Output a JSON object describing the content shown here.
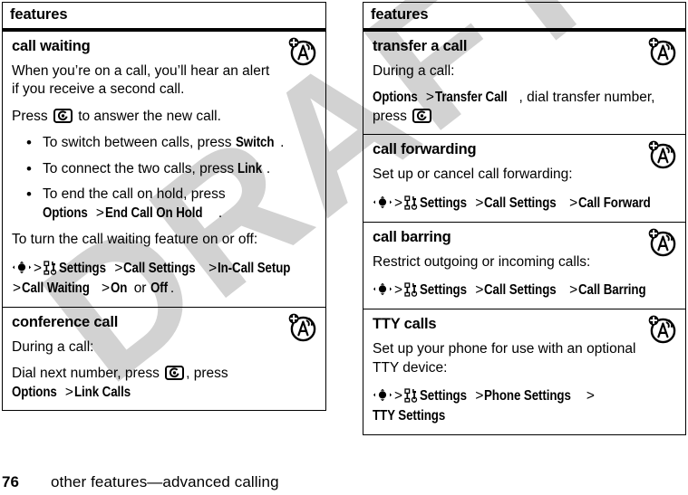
{
  "watermark": {
    "text": "DRAFT",
    "color": "#d2d2d2"
  },
  "footer": {
    "page_number": "76",
    "title": "other features—advanced calling"
  },
  "columns": [
    {
      "header": "features",
      "rows": [
        {
          "title": "call waiting",
          "icon": "network-service-a-icon",
          "paragraphs": [
            "When you’re on a call, you’ll hear an alert if you receive a second call."
          ],
          "press_line": {
            "pre": "Press ",
            "key": "send-key-icon",
            "post": " to answer the new call."
          },
          "bullets": [
            {
              "pre": "To switch between calls, press ",
              "cmd": "Switch",
              "post": "."
            },
            {
              "pre": "To connect the two calls, press ",
              "cmd": "Link",
              "post": "."
            },
            {
              "pre": "To end the call on hold, press ",
              "cmd": "Options",
              "sep": ">",
              "cmd2": "End Call On Hold",
              "post": "."
            }
          ],
          "closing": "To turn the call waiting feature on or off:",
          "path": {
            "navkey": "nav-key-icon",
            "tools": "settings-tools-icon",
            "steps": [
              "Settings",
              "Call Settings",
              "In-Call Setup",
              "Call Waiting",
              "On"
            ],
            "tail_or": "or",
            "tail_step": "Off",
            "tail_period": "."
          }
        },
        {
          "title": "conference call",
          "icon": "network-service-a-icon",
          "paragraphs": [
            "During a call:"
          ],
          "dial_line": {
            "pre": "Dial next number, press ",
            "key": "send-key-icon",
            "mid": ", press",
            "cmd": "Options",
            "sep": ">",
            "cmd2": "Link Calls"
          }
        }
      ]
    },
    {
      "header": "features",
      "rows": [
        {
          "title": "transfer a call",
          "icon": "network-service-a-icon",
          "paragraphs": [
            "During a call:"
          ],
          "transfer_line": {
            "cmd": "Options",
            "sep": ">",
            "cmd2": "Transfer Call",
            "mid": ", dial transfer number, press ",
            "key": "send-key-icon"
          }
        },
        {
          "title": "call forwarding",
          "icon": "network-service-a-icon",
          "paragraphs": [
            "Set up or cancel call forwarding:"
          ],
          "path": {
            "navkey": "nav-key-icon",
            "tools": "settings-tools-icon",
            "steps": [
              "Settings",
              "Call Settings",
              "Call Forward"
            ]
          }
        },
        {
          "title": "call barring",
          "icon": "network-service-a-icon",
          "paragraphs": [
            "Restrict outgoing or incoming calls:"
          ],
          "path": {
            "navkey": "nav-key-icon",
            "tools": "settings-tools-icon",
            "steps": [
              "Settings",
              "Call Settings",
              "Call Barring"
            ]
          }
        },
        {
          "title": "TTY calls",
          "icon": "network-service-a-icon",
          "paragraphs": [
            "Set up your phone for use with an optional TTY device:"
          ],
          "path": {
            "navkey": "nav-key-icon",
            "tools": "settings-tools-icon",
            "steps": [
              "Settings",
              "Phone Settings",
              "TTY Settings"
            ]
          }
        }
      ]
    }
  ]
}
